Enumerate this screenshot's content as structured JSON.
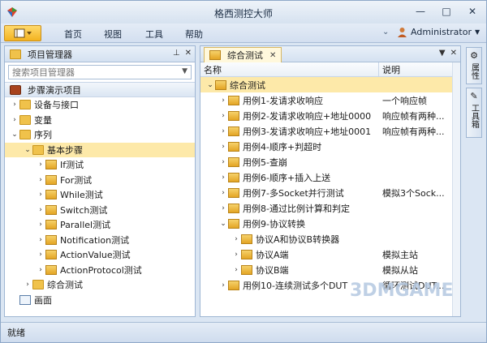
{
  "window": {
    "title": "格西测控大师"
  },
  "menubar": {
    "items": [
      "首页",
      "视图",
      "工具",
      "帮助"
    ],
    "user": "Administrator"
  },
  "project_panel": {
    "title": "项目管理器",
    "search_placeholder": "搜索项目管理器",
    "section_title": "步骤演示项目",
    "tree": [
      {
        "label": "设备与接口",
        "level": 0,
        "toggle": ">",
        "icon": "device-folder-icon"
      },
      {
        "label": "变量",
        "level": 0,
        "toggle": ">",
        "icon": "variable-folder-icon"
      },
      {
        "label": "序列",
        "level": 0,
        "toggle": "v",
        "icon": "sequence-folder-icon"
      },
      {
        "label": "基本步骤",
        "level": 1,
        "toggle": "v",
        "icon": "step-folder-icon",
        "selected": true
      },
      {
        "label": "If测试",
        "level": 2,
        "toggle": ">",
        "icon": "step-icon"
      },
      {
        "label": "For测试",
        "level": 2,
        "toggle": ">",
        "icon": "step-icon"
      },
      {
        "label": "While测试",
        "level": 2,
        "toggle": ">",
        "icon": "step-icon"
      },
      {
        "label": "Switch测试",
        "level": 2,
        "toggle": ">",
        "icon": "step-icon"
      },
      {
        "label": "Parallel测试",
        "level": 2,
        "toggle": ">",
        "icon": "step-icon"
      },
      {
        "label": "Notification测试",
        "level": 2,
        "toggle": ">",
        "icon": "step-icon"
      },
      {
        "label": "ActionValue测试",
        "level": 2,
        "toggle": ">",
        "icon": "step-icon"
      },
      {
        "label": "ActionProtocol测试",
        "level": 2,
        "toggle": ">",
        "icon": "step-icon"
      },
      {
        "label": "综合测试",
        "level": 1,
        "toggle": ">",
        "icon": "step-folder-icon"
      },
      {
        "label": "画面",
        "level": 0,
        "toggle": "",
        "icon": "screen-icon"
      }
    ]
  },
  "document": {
    "tab_label": "综合测试",
    "columns": {
      "name": "名称",
      "desc": "说明"
    },
    "rows": [
      {
        "name": "综合测试",
        "desc": "",
        "level": 0,
        "toggle": "v",
        "selected": true
      },
      {
        "name": "用例1-发请求收响应",
        "desc": "一个响应帧",
        "level": 1,
        "toggle": ">"
      },
      {
        "name": "用例2-发请求收响应+地址0000",
        "desc": "响应帧有两种...",
        "level": 1,
        "toggle": ">"
      },
      {
        "name": "用例3-发请求收响应+地址0001",
        "desc": "响应帧有两种...",
        "level": 1,
        "toggle": ">"
      },
      {
        "name": "用例4-顺序+判超时",
        "desc": "",
        "level": 1,
        "toggle": ">"
      },
      {
        "name": "用例5-查崩",
        "desc": "",
        "level": 1,
        "toggle": ">"
      },
      {
        "name": "用例6-顺序+插入上送",
        "desc": "",
        "level": 1,
        "toggle": ">"
      },
      {
        "name": "用例7-多Socket并行测试",
        "desc": "模拟3个Sock...",
        "level": 1,
        "toggle": ">"
      },
      {
        "name": "用例8-通过比例计算和判定",
        "desc": "",
        "level": 1,
        "toggle": ">"
      },
      {
        "name": "用例9-协议转换",
        "desc": "",
        "level": 1,
        "toggle": "v"
      },
      {
        "name": "协议A和协议B转换器",
        "desc": "",
        "level": 2,
        "toggle": ">"
      },
      {
        "name": "协议A端",
        "desc": "模拟主站",
        "level": 2,
        "toggle": ">"
      },
      {
        "name": "协议B端",
        "desc": "模拟从站",
        "level": 2,
        "toggle": ">"
      },
      {
        "name": "用例10-连续测试多个DUT",
        "desc": "循环测试DUT...",
        "level": 1,
        "toggle": ">"
      }
    ]
  },
  "side_tabs": [
    "属性",
    "工具箱"
  ],
  "status": "就绪",
  "watermark": "3DMGAME"
}
